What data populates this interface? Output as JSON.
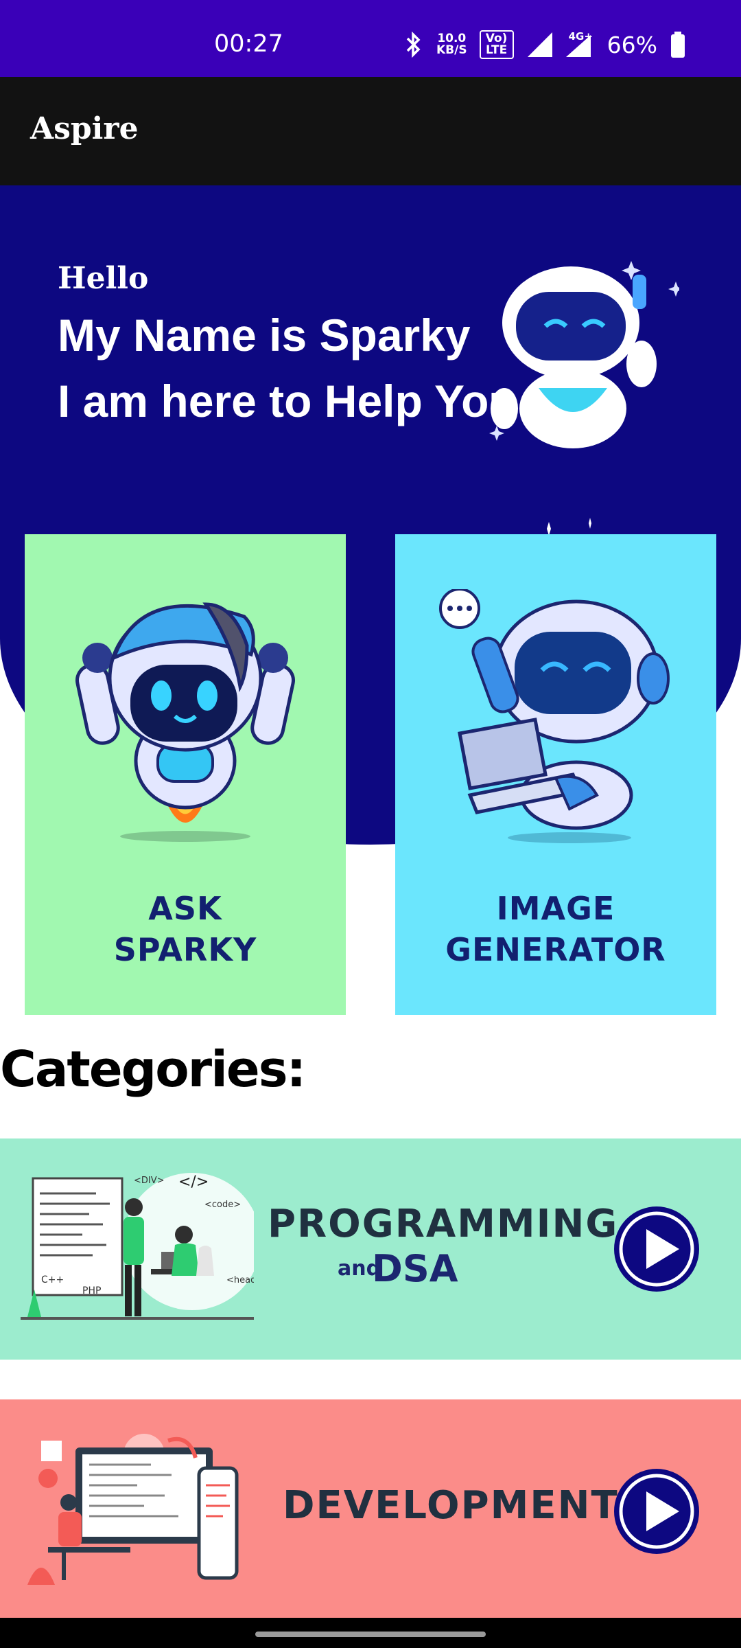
{
  "status_bar": {
    "time": "00:27",
    "net_speed_value": "10.0",
    "net_speed_unit": "KB/S",
    "volte": "Vo) LTE",
    "network": "4G+",
    "battery": "66%"
  },
  "app_bar": {
    "title": "Aspire"
  },
  "hero": {
    "greeting": "Hello",
    "line1": "My Name is Sparky",
    "line2": "I am here to Help You"
  },
  "cards": {
    "ask": {
      "line1": "ASK",
      "line2": "SPARKY"
    },
    "image": {
      "line1": "IMAGE",
      "line2": "GENERATOR"
    }
  },
  "categories": {
    "heading": "Categories:",
    "items": [
      {
        "title": "PROGRAMMING",
        "sub_and": "and",
        "sub": "DSA",
        "code_tags": [
          "<DIV>",
          "</>",
          "<code>",
          "<head>",
          "C++",
          "PHP"
        ]
      },
      {
        "title": "DEVELOPMENT"
      }
    ]
  },
  "colors": {
    "status_bar": "#3a00b8",
    "app_bar": "#121212",
    "hero_bg": "#0d0881",
    "ask_card": "#a1f8b0",
    "image_card": "#6be6fd",
    "programming_banner": "#9cecce",
    "development_banner": "#fb8c89",
    "play_button": "#0d0881"
  }
}
